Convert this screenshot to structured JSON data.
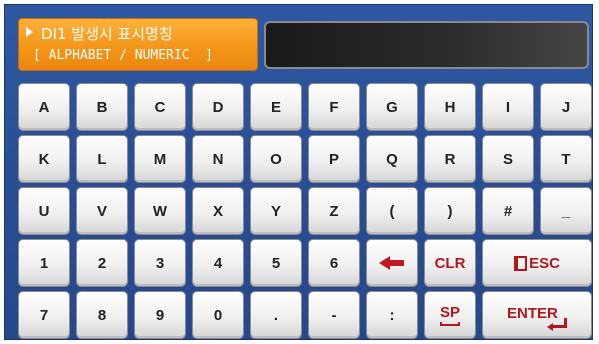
{
  "header": {
    "title": "DI1 발생시 표시명칭",
    "subtitle": "[ ALPHABET / NUMERIC  ]"
  },
  "display": {
    "value": ""
  },
  "keyboard": {
    "rows": [
      [
        "A",
        "B",
        "C",
        "D",
        "E",
        "F",
        "G",
        "H",
        "I",
        "J"
      ],
      [
        "K",
        "L",
        "M",
        "N",
        "O",
        "P",
        "Q",
        "R",
        "S",
        "T"
      ],
      [
        "U",
        "V",
        "W",
        "X",
        "Y",
        "Z",
        "(",
        ")",
        "#",
        "_"
      ],
      [
        "1",
        "2",
        "3",
        "4",
        "5",
        "6"
      ],
      [
        "7",
        "8",
        "9",
        "0",
        ".",
        "-",
        ":"
      ]
    ],
    "special": {
      "backspace_icon": "left-arrow-icon",
      "clr_label": "CLR",
      "esc_label": "ESC",
      "esc_icon": "book-icon",
      "sp_label": "SP",
      "sp_icon": "space-icon",
      "enter_label": "ENTER",
      "enter_icon": "enter-icon"
    }
  },
  "colors": {
    "background": "#2b519a",
    "header_accent": "#f39417",
    "key_face": "#f0f0f0",
    "special_text": "#b3161c",
    "display_bg": "#1e1e1e"
  }
}
